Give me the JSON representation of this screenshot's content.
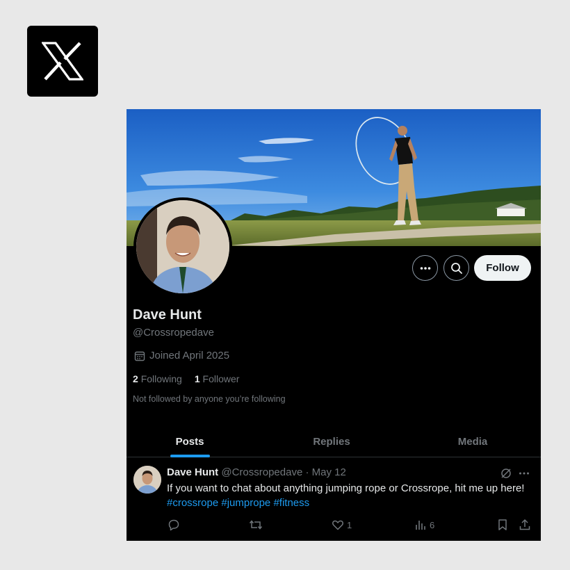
{
  "logo": {
    "icon": "x-logo-icon"
  },
  "profile": {
    "name": "Dave Hunt",
    "handle": "@Crossropedave",
    "joined": "Joined April 2025",
    "following_count": "2",
    "following_label": "Following",
    "followers_count": "1",
    "followers_label": "Follower",
    "not_followed_text": "Not followed by anyone you’re following"
  },
  "actions": {
    "follow_label": "Follow",
    "more_icon": "more-icon",
    "search_icon": "search-icon"
  },
  "tabs": [
    {
      "label": "Posts",
      "active": true
    },
    {
      "label": "Replies",
      "active": false
    },
    {
      "label": "Media",
      "active": false
    }
  ],
  "post": {
    "author": "Dave Hunt",
    "handle": "@Crossropedave",
    "separator": "·",
    "date": "May 12",
    "text": "If you want to chat about anything jumping rope or Crossrope, hit me up here!",
    "hashtags": [
      "#crossrope",
      "#jumprope",
      "#fitness"
    ],
    "likes": "1",
    "views": "6"
  },
  "colors": {
    "accent": "#1d9bf0",
    "background": "#000000",
    "muted": "#71767b"
  }
}
